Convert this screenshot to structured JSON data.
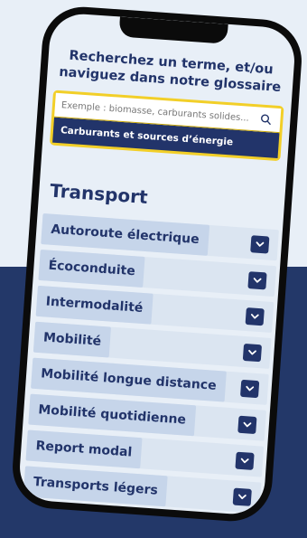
{
  "headline": "Recherchez un terme, et/ou naviguez dans notre glossaire",
  "search": {
    "placeholder": "Exemple : biomasse, carburants solides...",
    "icon": "search-icon"
  },
  "category_filter": "Carburants et sources d’énergie",
  "section_title": "Transport",
  "terms": [
    {
      "label": "Autoroute électrique"
    },
    {
      "label": "Écoconduite"
    },
    {
      "label": "Intermodalité"
    },
    {
      "label": "Mobilité"
    },
    {
      "label": "Mobilité longue distance"
    },
    {
      "label": "Mobilité quotidienne"
    },
    {
      "label": "Report modal"
    },
    {
      "label": "Transports légers"
    }
  ],
  "colors": {
    "navy": "#22346a",
    "highlight": "#f2cf28",
    "light_bg": "#e8eff7",
    "chip": "#c6d5ea"
  }
}
